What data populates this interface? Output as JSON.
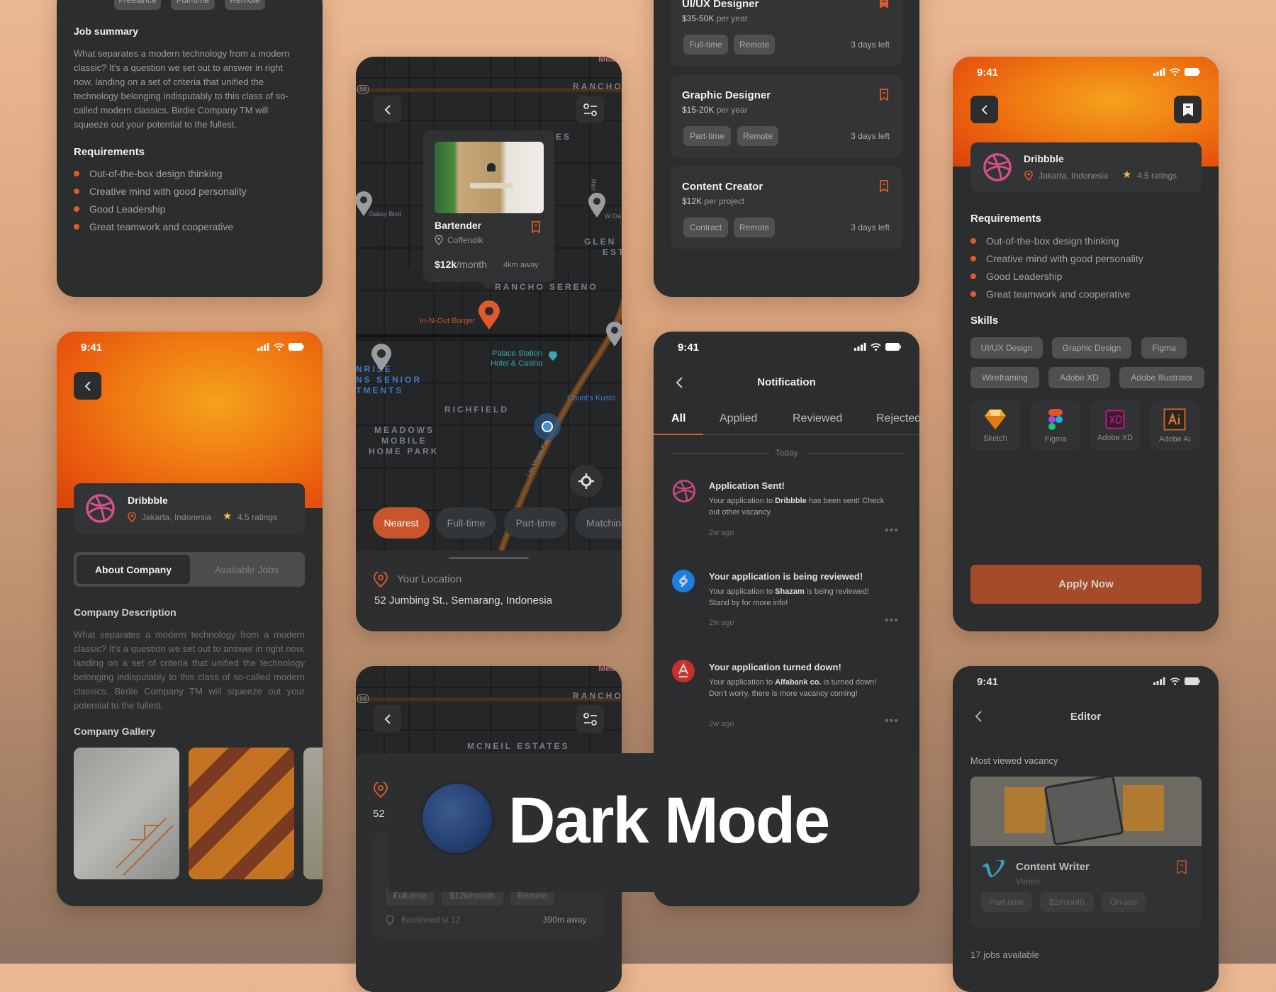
{
  "colors": {
    "accent": "#e0592a",
    "panel": "#2b2d2f",
    "card": "#323436",
    "dribbble": "#d94f8a",
    "shazam": "#1a7fe0",
    "alfabank": "#c8302a",
    "vimeo": "#3aa5c9"
  },
  "status_time": "9:41",
  "job_detail_top": {
    "tags": [
      "Freelance",
      "Full-time",
      "Remote"
    ],
    "summary_title": "Job summary",
    "summary": "What separates a modern technology from a modern classic? It's a question we set out to answer in right now, landing on a set of criteria that unified the technology belonging indisputably to this class of so-called modern classics. Birdie Company TM will squeeze out your potential to the fullest.",
    "requirements_title": "Requirements",
    "requirements": [
      "Out-of-the-box design thinking",
      "Creative mind with good personality",
      "Good Leadership",
      "Great teamwork and cooperative"
    ]
  },
  "company": {
    "name": "Dribbble",
    "location": "Jakarta, Indonesia",
    "rating": "4.5 ratings",
    "tabs": [
      "About Company",
      "Available Jobs"
    ],
    "active_tab": "About Company",
    "description_title": "Company Description",
    "description": "What separates a modern technology from a modern classic? It's a question we set out to answer in right now, landing on a set of criteria that unified the technology belonging indisputably to this class of so-called modern classics. Birdie Company TM will squeeze out your potential to the fullest.",
    "gallery_title": "Company Gallery"
  },
  "map": {
    "labels": {
      "rancho": "RANCHO",
      "es": "ES",
      "glen": "GLEN",
      "est": "EST",
      "rancho_sereno": "RANCHO SERENO",
      "innout": "In-N-Out Burger",
      "palace": "Palace Station",
      "palace2": "Hotel & Casino",
      "sunrise1": "NRISE",
      "sunrise2": "NS SENIOR",
      "sunrise3": "TMENTS",
      "richfield": "RICHFIELD",
      "meadows1": "MEADOWS",
      "meadows2": "MOBILE",
      "meadows3": "HOME PARK",
      "counts": "Count's Kusto",
      "fwy": "Las Vegas Fwy",
      "oakey": "Oakey Blvd",
      "woa": "W Oa",
      "ran": "Ran",
      "mea": "Mea",
      "route": "59",
      "mcneil": "MCNEIL ESTATES"
    },
    "popup": {
      "title": "Bartender",
      "company": "Coffendik",
      "salary": "$12k",
      "salary_unit": "/month",
      "distance": "4km away"
    },
    "filters": [
      "Nearest",
      "Full-time",
      "Part-time",
      "Matching"
    ],
    "active_filter": "Nearest",
    "location_label": "Your Location",
    "address": "52 Jumbing St., Semarang, Indonesia"
  },
  "map2": {
    "address_partial": "52",
    "tags": [
      "Full-time",
      "$12k/month",
      "Remote"
    ],
    "place": "Boulevard st 12",
    "distance": "390m away"
  },
  "jobs": [
    {
      "title": "UI/UX Designer",
      "salary": "$35-50K",
      "period": "per year",
      "tags": [
        "Full-time",
        "Remote"
      ],
      "left": "3 days left",
      "saved": true
    },
    {
      "title": "Graphic Designer",
      "salary": "$15-20K",
      "period": "per year",
      "tags": [
        "Part-time",
        "Remote"
      ],
      "left": "3 days left",
      "saved": false
    },
    {
      "title": "Content Creator",
      "salary": "$12K",
      "period": "per project",
      "tags": [
        "Contract",
        "Remote"
      ],
      "left": "3 days left",
      "saved": false
    }
  ],
  "notifications": {
    "title": "Notification",
    "tabs": [
      "All",
      "Applied",
      "Reviewed",
      "Rejected"
    ],
    "active_tab": "All",
    "section": "Today",
    "items": [
      {
        "title": "Application Sent!",
        "pre": "Your application to ",
        "company": "Dribbble",
        "post": " has been sent! Check out other vacancy.",
        "time": "2w ago"
      },
      {
        "title": "Your application is being reviewed!",
        "pre": "Your application to ",
        "company": "Shazam",
        "post": " is being reviewed! Stand by for more info!",
        "time": "2w ago"
      },
      {
        "title": "Your application turned down!",
        "pre": "Your application to ",
        "company": "Alfabank co.",
        "post": " is turned down! Don't worry, there is more vacancy coming!",
        "time": "2w ago"
      }
    ]
  },
  "job_detail_right": {
    "company": "Dribbble",
    "location": "Jakarta, Indonesia",
    "rating": "4.5 ratings",
    "requirements_title": "Requirements",
    "requirements": [
      "Out-of-the-box design thinking",
      "Creative mind with good personality",
      "Good Leadership",
      "Great teamwork and cooperative"
    ],
    "skills_title": "Skills",
    "skills": [
      "UI/UX Design",
      "Graphic Design",
      "Figma",
      "Wireframing",
      "Adobe XD",
      "Adobe Illustrator"
    ],
    "tools": [
      "Sketch",
      "Figma",
      "Adobe XD",
      "Adobe Ai"
    ],
    "apply": "Apply Now"
  },
  "editor": {
    "title": "Editor",
    "section": "Most viewed vacancy",
    "job": {
      "title": "Content Writer",
      "company": "Vimeo",
      "tags": [
        "Part-time",
        "$2/month",
        "On-site"
      ]
    },
    "count": "17 jobs available"
  },
  "banner": {
    "text": "Dark Mode"
  }
}
